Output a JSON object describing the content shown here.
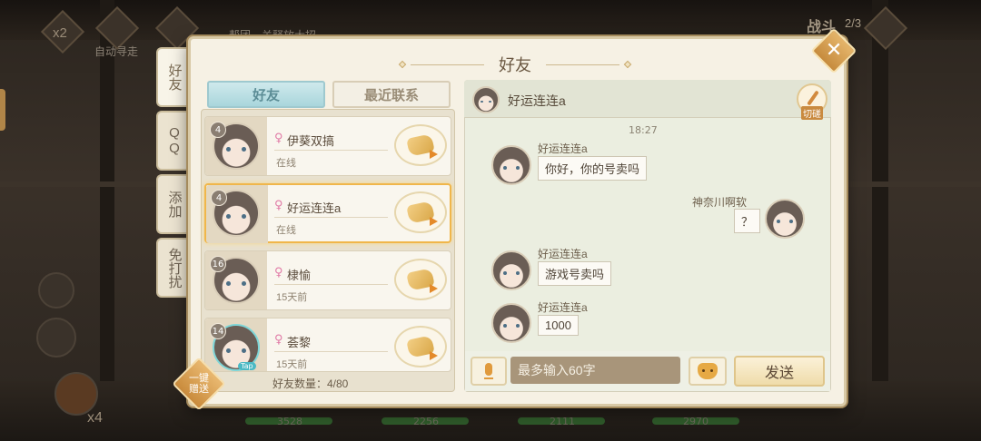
{
  "background": {
    "multiplier_top": "x2",
    "auto_path": "自动寻走",
    "quest_text": "帮团一关释放大招",
    "battle_label": "战斗",
    "battle_progress": "2/3",
    "multiplier_bottom": "x4",
    "bar_values": [
      "3528",
      "2256",
      "2111",
      "2970"
    ]
  },
  "dialog": {
    "title": "好友",
    "close_label": "✕"
  },
  "side_tabs": [
    {
      "label": "好友",
      "active": true
    },
    {
      "label": "QQ",
      "active": false
    },
    {
      "label": "添加",
      "active": false
    },
    {
      "label": "免打扰",
      "active": false
    }
  ],
  "list_tabs": {
    "friends": "好友",
    "recent": "最近联系"
  },
  "friends": [
    {
      "level": "4",
      "name": "伊葵双搞",
      "status": "在线",
      "selected": false
    },
    {
      "level": "4",
      "name": "好运连连a",
      "status": "在线",
      "selected": true
    },
    {
      "level": "16",
      "name": "棣愉",
      "status": "15天前",
      "selected": false
    },
    {
      "level": "14",
      "name": "荟黎",
      "status": "15天前",
      "selected": false,
      "tag": "Tap"
    }
  ],
  "friend_count": "好友数量：4/80",
  "bulk_gift": "一键\n赠送",
  "chat": {
    "partner_name": "好运连连a",
    "switch_label": "切磋",
    "time": "18:27",
    "messages": [
      {
        "sender": "好运连连a",
        "text": "你好，你的号卖吗",
        "side": "left"
      },
      {
        "sender": "神奈川啊软",
        "text": "？",
        "side": "right"
      },
      {
        "sender": "好运连连a",
        "text": "游戏号卖吗",
        "side": "left"
      },
      {
        "sender": "好运连连a",
        "text": "1000",
        "side": "left"
      }
    ],
    "input_placeholder": "最多输入60字",
    "send_label": "发送"
  }
}
